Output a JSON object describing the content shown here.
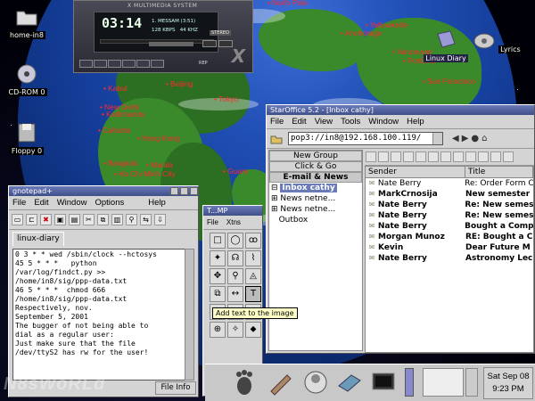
{
  "desktop": {
    "icons": [
      {
        "label": "home-in8",
        "icon": "folder-icon"
      },
      {
        "label": "CD-ROM 0",
        "icon": "cdrom-icon"
      },
      {
        "label": "Floppy 0",
        "icon": "floppy-icon"
      },
      {
        "label": "Linux Diary",
        "icon": "notebook-icon"
      },
      {
        "label": "Lyrics",
        "icon": "lyrics-icon"
      }
    ],
    "cities": [
      "North Pole",
      "Yellowknife",
      "Anchorage",
      "Vancouver",
      "Portland",
      "San Francisco",
      "Kabul",
      "Beijing",
      "New Delhi",
      "Kathmandu",
      "Tokyo",
      "Calcutta",
      "Hong Kong",
      "Bangkok",
      "Manila",
      "Ho Chi Minh City",
      "Guam"
    ]
  },
  "xmms": {
    "title": "X MULTIMEDIA SYSTEM",
    "time": "03:14",
    "song": "1. MESSAM (3:51)",
    "kbps": "128 KBPS",
    "khz": "44 KHZ",
    "stereo": "STEREO",
    "logo": "X",
    "rep": "REP"
  },
  "gnotepad": {
    "title": "gnotepad+",
    "menus": [
      "File",
      "Edit",
      "Window",
      "Options",
      "Help"
    ],
    "tab": "linux-diary",
    "lines": [
      "0 3 * * wed /sbin/clock --hctosys",
      "45 5 * * *   python",
      "/var/log/findct.py >>",
      "/home/in8/sig/ppp-data.txt",
      "46 5 * * *  chmod 666",
      "/home/in8/sig/ppp-data.txt",
      "",
      "Respectively, nov.",
      "",
      "September 5, 2001",
      "The bugger of not being able to",
      "dial as a regular user:",
      "Just make sure that the file",
      "/dev/ttyS2 has rw for the user!"
    ],
    "file_info": "File Info"
  },
  "gimp": {
    "title": "T...MP",
    "menus": [
      "File",
      "Xtns"
    ],
    "tools": [
      "□",
      "◯",
      "ꝏ",
      "✦",
      "☊",
      "⌇",
      "✥",
      "⚲",
      "◬",
      "⧉",
      "↔",
      "T",
      "✎",
      "✏",
      "⬭",
      "⊕",
      "✧",
      "⬥"
    ],
    "tooltip": "Add text to the image"
  },
  "staroffice": {
    "title": "StarOffice 5.2 - [Inbox cathy]",
    "menus": [
      "File",
      "Edit",
      "View",
      "Tools",
      "Window",
      "Help"
    ],
    "url": "pop3://in8@192.168.100.119/",
    "groups": [
      "New Group",
      "Click & Go",
      "E-mail & News"
    ],
    "tree": [
      "Inbox cathy",
      "News netne...",
      "News netne...",
      "Outbox"
    ],
    "columns": {
      "sender": "Sender",
      "title": "Title"
    },
    "messages": [
      {
        "sender": "Nate Berry",
        "title": "Re: Order Form C"
      },
      {
        "sender": "MarkCrnosija",
        "title": "New semester"
      },
      {
        "sender": "Nate Berry",
        "title": "Re: New semes"
      },
      {
        "sender": "Nate Berry",
        "title": "Re: New semes"
      },
      {
        "sender": "Nate Berry",
        "title": "Bought a Comp"
      },
      {
        "sender": "Morgan Munoz",
        "title": "RE: Bought a C"
      },
      {
        "sender": "Kevin",
        "title": "Dear Future M"
      },
      {
        "sender": "Nate Berry",
        "title": "Astronomy Lec"
      }
    ]
  },
  "clock": {
    "date": "Sat Sep 08",
    "time": "9:23 PM"
  },
  "watermark": "N8sWoRLd"
}
